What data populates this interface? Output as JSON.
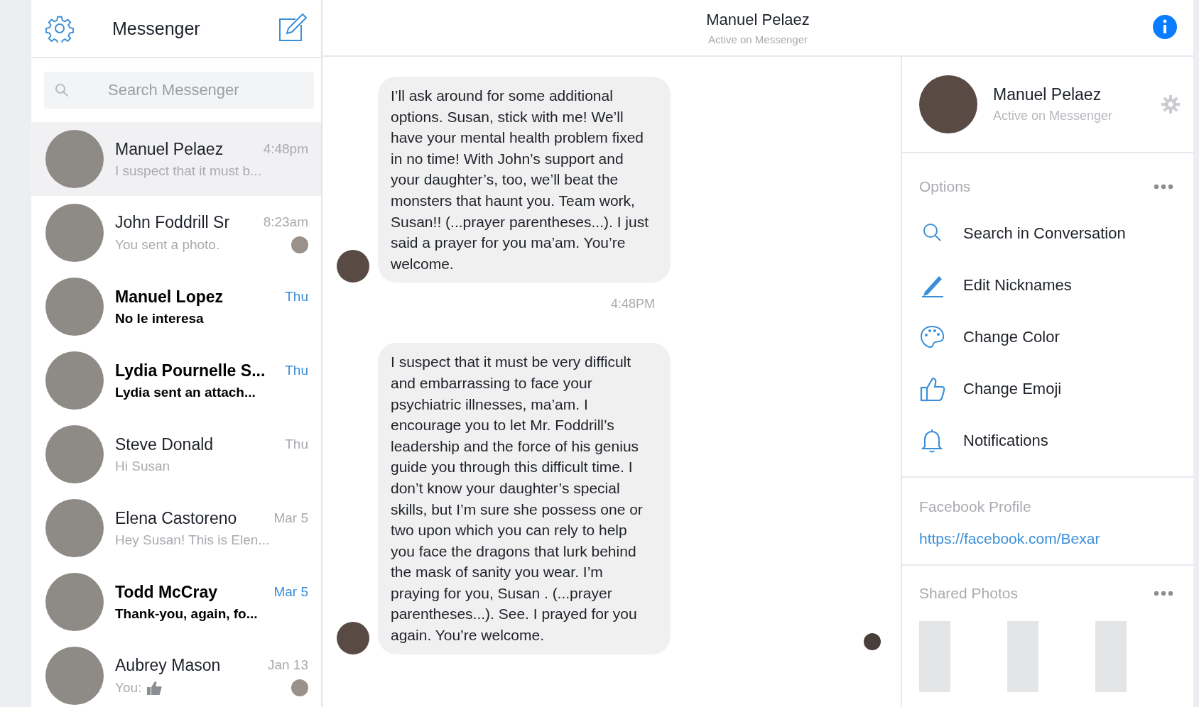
{
  "sidebar": {
    "title": "Messenger",
    "search": {
      "placeholder": "Search Messenger"
    },
    "conversations": [
      {
        "name": "Manuel Pelaez",
        "time": "4:48pm",
        "snippet": "I suspect that it must b...",
        "unread": false,
        "selected": true,
        "seen_avatar": false,
        "like_icon": false
      },
      {
        "name": "John Foddrill Sr",
        "time": "8:23am",
        "snippet": "You sent a photo.",
        "unread": false,
        "selected": false,
        "seen_avatar": true,
        "like_icon": false
      },
      {
        "name": "Manuel Lopez",
        "time": "Thu",
        "snippet": "No le interesa",
        "unread": true,
        "selected": false,
        "seen_avatar": false,
        "like_icon": false
      },
      {
        "name": "Lydia Pournelle S...",
        "time": "Thu",
        "snippet": "Lydia sent an attach...",
        "unread": true,
        "selected": false,
        "seen_avatar": false,
        "like_icon": false
      },
      {
        "name": "Steve Donald",
        "time": "Thu",
        "snippet": "Hi Susan",
        "unread": false,
        "selected": false,
        "seen_avatar": false,
        "like_icon": false
      },
      {
        "name": "Elena Castoreno",
        "time": "Mar 5",
        "snippet": "Hey Susan! This is Elen...",
        "unread": false,
        "selected": false,
        "seen_avatar": false,
        "like_icon": false
      },
      {
        "name": "Todd McCray",
        "time": "Mar 5",
        "snippet": "Thank-you, again, fo...",
        "unread": true,
        "selected": false,
        "seen_avatar": false,
        "like_icon": false
      },
      {
        "name": "Aubrey Mason",
        "time": "Jan 13",
        "snippet": "You:",
        "unread": false,
        "selected": false,
        "seen_avatar": true,
        "like_icon": true
      }
    ]
  },
  "chat": {
    "title": "Manuel Pelaez",
    "status": "Active on Messenger",
    "items": [
      {
        "kind": "message",
        "text": "I’ll ask around for some additional options. Susan, stick with me!  We’ll have your mental health problem fixed in no time! With John’s support and your daughter’s, too, we’ll beat the monsters that haunt you. Team work, Susan!!  (...prayer parentheses...). I just said a prayer for you ma’am. You’re welcome."
      },
      {
        "kind": "timestamp",
        "text": "4:48PM"
      },
      {
        "kind": "message",
        "text": "I suspect that it must be very difficult and embarrassing to face your psychiatric illnesses, ma’am. I encourage you to let Mr. Foddrill’s leadership and the force of his genius guide you through this difficult time. I don’t know your daughter’s special skills, but I’m sure she possess one or two upon which you can rely to help you face the dragons that lurk behind the mask of sanity you wear. I’m praying for you, Susan . (...prayer parentheses...).  See. I prayed for you again. You’re welcome."
      }
    ],
    "seen_avatar": true
  },
  "details": {
    "name": "Manuel Pelaez",
    "status": "Active on Messenger",
    "options": {
      "title": "Options",
      "items": [
        {
          "kind": "search",
          "label": "Search in Conversation"
        },
        {
          "kind": "pencil",
          "label": "Edit Nicknames"
        },
        {
          "kind": "palette",
          "label": "Change Color"
        },
        {
          "kind": "thumb",
          "label": "Change Emoji"
        },
        {
          "kind": "bell",
          "label": "Notifications"
        }
      ]
    },
    "profile": {
      "title": "Facebook Profile",
      "link": "https://facebook.com/Bexar"
    },
    "shared_photos": {
      "title": "Shared Photos"
    }
  }
}
